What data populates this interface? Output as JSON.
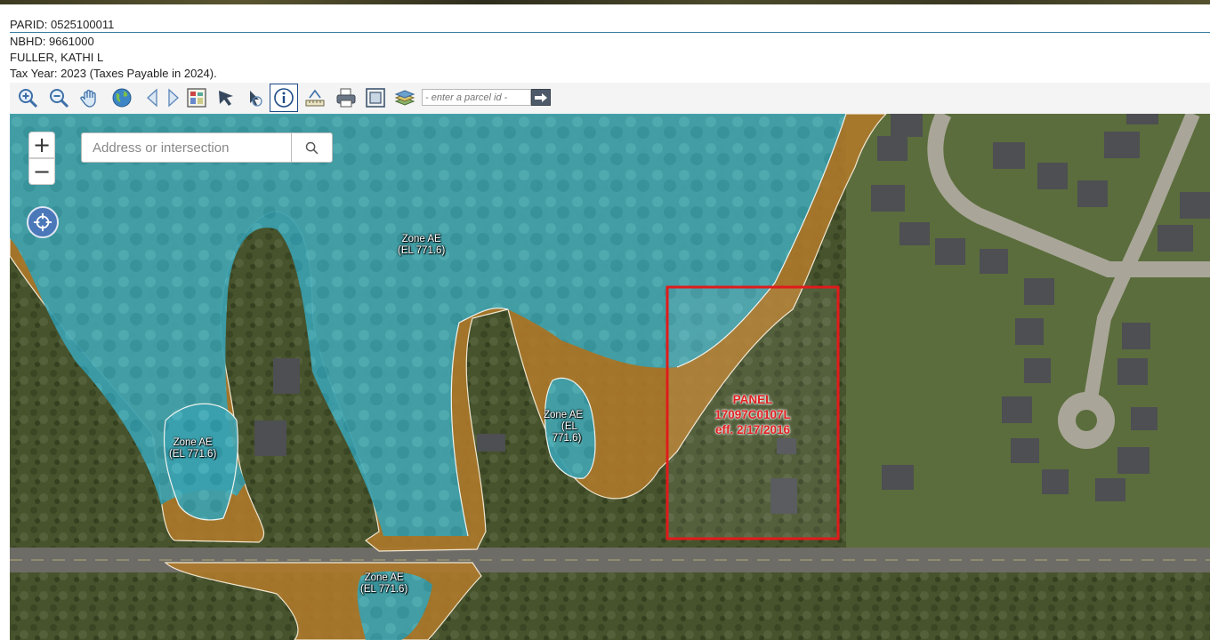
{
  "parcel": {
    "parid": "PARID: 0525100011",
    "nbhd": "NBHD: 9661000",
    "owner": "FULLER, KATHI L",
    "tax_year": "Tax Year: 2023 (Taxes Payable in 2024)."
  },
  "toolbar": {
    "tools": [
      "zoom-in-icon",
      "zoom-out-icon",
      "pan-hand-icon",
      "globe-icon",
      "back-arrow-icon",
      "forward-arrow-icon",
      "map-legend-icon",
      "select-arrow-icon",
      "identify-arrow-icon",
      "info-icon",
      "measure-icon",
      "print-icon",
      "full-extent-icon",
      "layers-icon"
    ],
    "active_tool": "info-icon",
    "parcel_placeholder": "- enter a parcel id -"
  },
  "map": {
    "search_placeholder": "Address or intersection",
    "zoom_in": "+",
    "zoom_out": "−",
    "zone_labels": [
      {
        "line1": "Zone AE",
        "line2": "(EL 771.6)"
      },
      {
        "line1": "Zone AE",
        "line2": "(EL 771.6)"
      },
      {
        "line1": "Zone AE",
        "line2": "(EL",
        "line3": "771.6)"
      },
      {
        "line1": "Zone AE",
        "line2": "(EL 771.6)"
      }
    ],
    "panel": {
      "line1": "PANEL",
      "line2": "17097C0107L",
      "line3": "eff. 2/17/2016"
    },
    "colors": {
      "flood_zone": "#2fa0b0",
      "floodway_fringe": "#b07a2a",
      "panel_outline": "#e01b1b"
    }
  }
}
